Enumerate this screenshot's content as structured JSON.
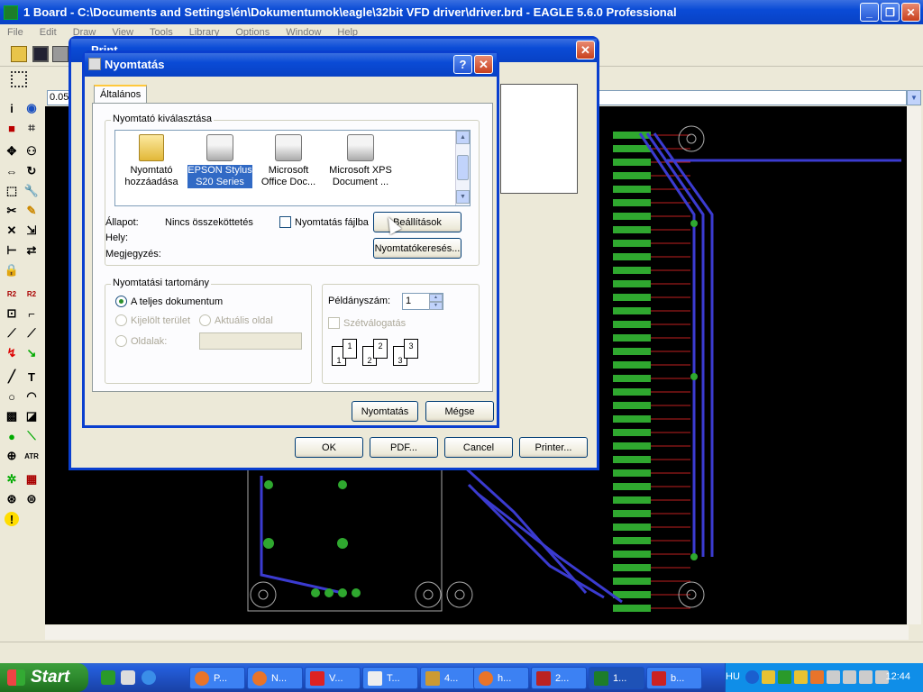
{
  "window": {
    "title": "1 Board - C:\\Documents and Settings\\én\\Dokumentumok\\eagle\\32bit VFD driver\\driver.brd - EAGLE 5.6.0 Professional"
  },
  "menu": [
    "File",
    "Edit",
    "Draw",
    "View",
    "Tools",
    "Library",
    "Options",
    "Window",
    "Help"
  ],
  "coord": "0.05",
  "print_dialog": {
    "title": "Print",
    "buttons": {
      "ok": "OK",
      "pdf": "PDF...",
      "cancel": "Cancel",
      "printer": "Printer..."
    }
  },
  "nyomtatas_dialog": {
    "title": "Nyomtatás",
    "tab": "Általános",
    "printer_group": "Nyomtató kiválasztása",
    "printers": [
      {
        "line1": "Nyomtató",
        "line2": "hozzáadása",
        "icon": "add-printer-icon",
        "selected": false
      },
      {
        "line1": "EPSON Stylus",
        "line2": "S20 Series",
        "icon": "printer-icon",
        "selected": true
      },
      {
        "line1": "Microsoft",
        "line2": "Office Doc...",
        "icon": "printer-icon",
        "selected": false
      },
      {
        "line1": "Microsoft XPS",
        "line2": "Document ...",
        "icon": "printer-icon",
        "selected": false
      }
    ],
    "status_label": "Állapot:",
    "status_value": "Nincs összeköttetés",
    "location_label": "Hely:",
    "comment_label": "Megjegyzés:",
    "print_to_file": "Nyomtatás fájlba",
    "settings_button": "Beállítások",
    "find_printer_button": "Nyomtatókeresés...",
    "range_group": "Nyomtatási tartomány",
    "range_all": "A teljes dokumentum",
    "range_selection": "Kijelölt terület",
    "range_current": "Aktuális oldal",
    "range_pages": "Oldalak:",
    "copies_label": "Példányszám:",
    "copies_value": "1",
    "collate": "Szétválogatás",
    "collate_pages": [
      "1",
      "1",
      "2",
      "2",
      "3",
      "3"
    ],
    "print_button": "Nyomtatás",
    "cancel_button": "Mégse"
  },
  "taskbar": {
    "start": "Start",
    "items": [
      {
        "label": "P...",
        "icon": "firefox-icon"
      },
      {
        "label": "N...",
        "icon": "firefox-icon"
      },
      {
        "label": "V...",
        "icon": "app-icon"
      },
      {
        "label": "T...",
        "icon": "folder-icon"
      },
      {
        "label": "4...",
        "icon": "app-icon"
      },
      {
        "label": "h...",
        "icon": "firefox-icon"
      },
      {
        "label": "2...",
        "icon": "app-icon"
      },
      {
        "label": "1...",
        "icon": "eagle-icon"
      },
      {
        "label": "b...",
        "icon": "app-icon"
      }
    ],
    "lang": "HU",
    "clock": "12:44"
  },
  "colors": {
    "titlebar": "#0a4bd6",
    "canvas": "#000000",
    "trace": "#3b3bd0",
    "pad": "#2fa82f",
    "selection": "#316ac5"
  }
}
